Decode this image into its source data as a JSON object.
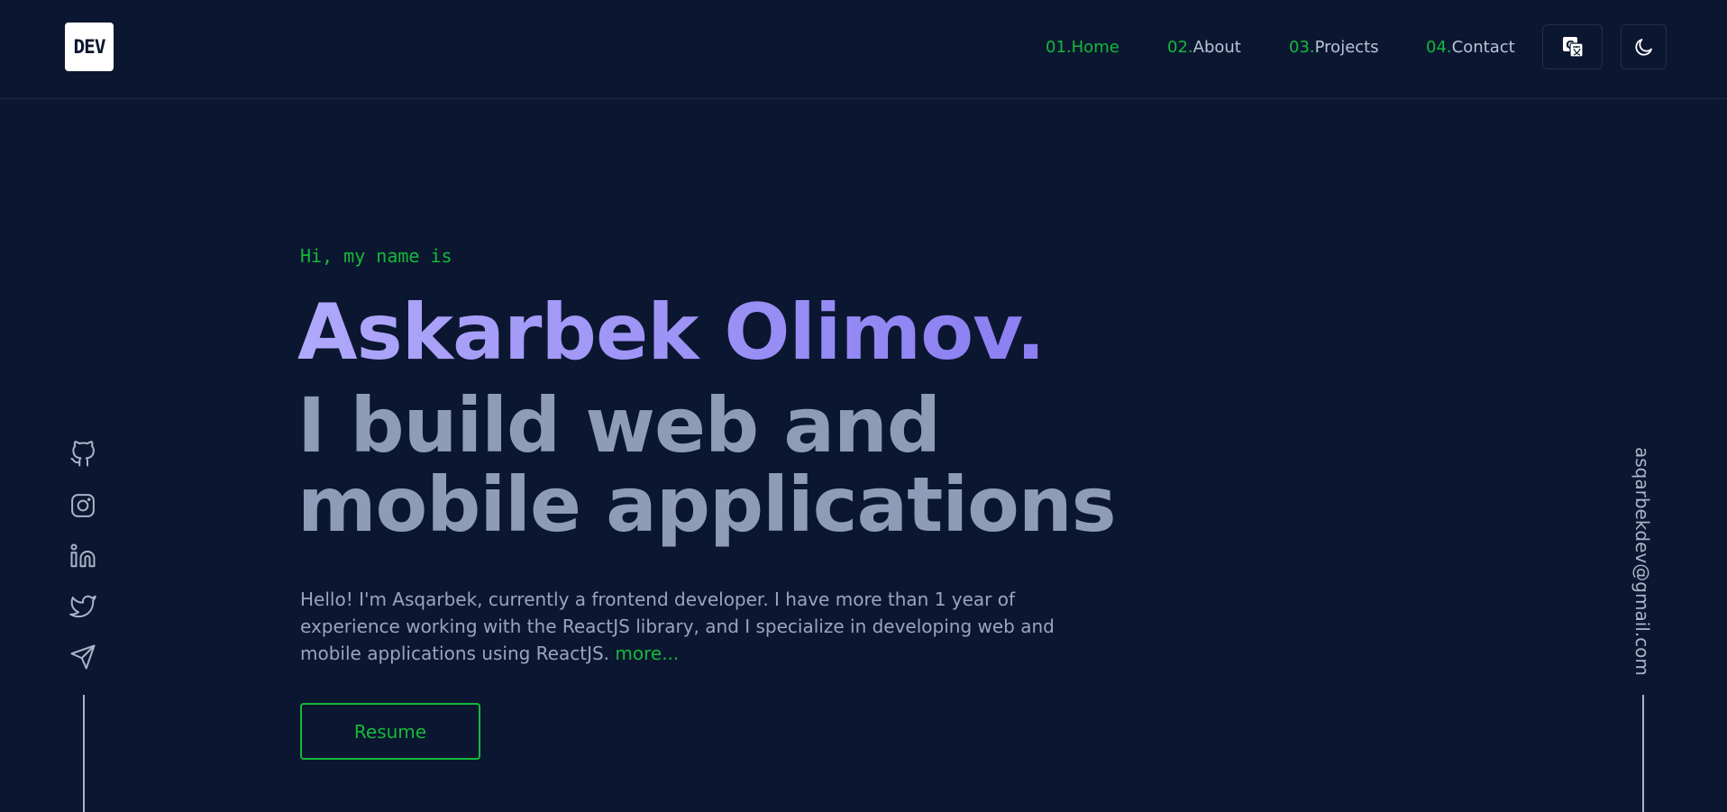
{
  "header": {
    "logo_text": "DEV",
    "nav": [
      {
        "num": "01.",
        "label": "Home",
        "active": true
      },
      {
        "num": "02.",
        "label": "About",
        "active": false
      },
      {
        "num": "03.",
        "label": "Projects",
        "active": false
      },
      {
        "num": "04.",
        "label": "Contact",
        "active": false
      }
    ],
    "translate_icon": "translate-icon",
    "theme_icon": "moon-icon"
  },
  "hero": {
    "greeting": "Hi, my name is",
    "name": "Askarbek Olimov.",
    "tagline": "I build web and mobile applications",
    "bio": "Hello! I'm Asqarbek, currently a frontend developer. I have more than 1 year of experience working with the ReactJS library, and I specialize in developing web and mobile applications using ReactJS.",
    "more_link": "more...",
    "resume_label": "Resume"
  },
  "social": [
    {
      "name": "github-icon"
    },
    {
      "name": "instagram-icon"
    },
    {
      "name": "linkedin-icon"
    },
    {
      "name": "twitter-icon"
    },
    {
      "name": "telegram-icon"
    }
  ],
  "email": "asqarbekdev@gmail.com",
  "colors": {
    "background": "#0b1730",
    "accent": "#16b83a",
    "name_gradient_start": "#b0a8fa",
    "name_gradient_end": "#8b7ef2",
    "tagline": "#8e9db7",
    "text": "#98a6bd"
  }
}
